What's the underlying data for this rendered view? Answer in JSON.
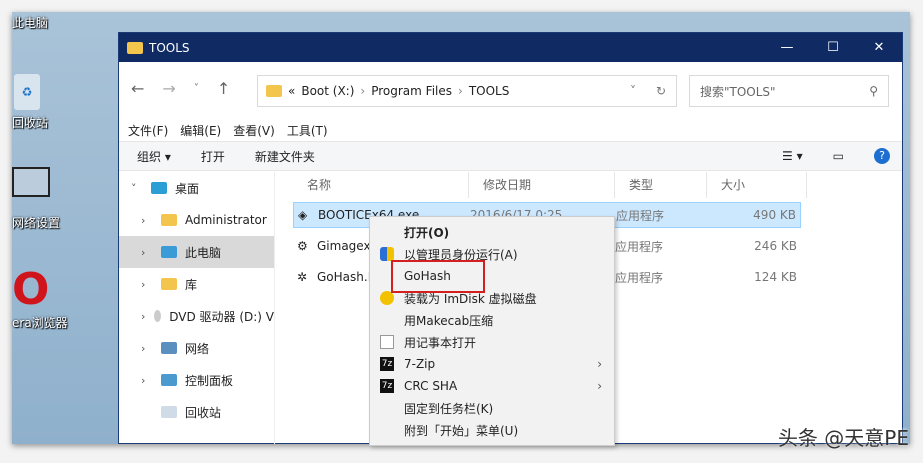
{
  "desktop": {
    "icons": [
      "此电脑",
      "回收站",
      "网络设置",
      "era浏览器"
    ]
  },
  "window": {
    "title": "TOOLS",
    "buttons": [
      "—",
      "☐",
      "✕"
    ]
  },
  "address": {
    "prefix": "«",
    "parts": [
      "Boot (X:)",
      "Program Files",
      "TOOLS"
    ],
    "search_placeholder": "搜索\"TOOLS\""
  },
  "menu": [
    "文件(F)",
    "编辑(E)",
    "查看(V)",
    "工具(T)"
  ],
  "toolbar": {
    "organize": "组织 ▾",
    "open": "打开",
    "new_folder": "新建文件夹"
  },
  "tree": [
    "桌面",
    "Administrator",
    "此电脑",
    "库",
    "DVD 驱动器 (D:) V",
    "网络",
    "控制面板",
    "回收站"
  ],
  "columns": [
    "名称",
    "修改日期",
    "类型",
    "大小"
  ],
  "files": [
    {
      "name": "BOOTICEx64.exe",
      "date": "2016/6/17 0:25",
      "type": "应用程序",
      "size": "490 KB"
    },
    {
      "name": "Gimagex.",
      "date": "",
      "type": "应用程序",
      "size": "246 KB"
    },
    {
      "name": "GoHash.E",
      "date": "",
      "type": "应用程序",
      "size": "124 KB"
    }
  ],
  "context_menu": [
    "打开(O)",
    "以管理员身份运行(A)",
    "GoHash",
    "装载为 ImDisk 虚拟磁盘",
    "用Makecab压缩",
    "用记事本打开",
    "7-Zip",
    "CRC SHA",
    "固定到任务栏(K)",
    "附到「开始」菜单(U)"
  ],
  "watermark": "头条 @天意PE"
}
